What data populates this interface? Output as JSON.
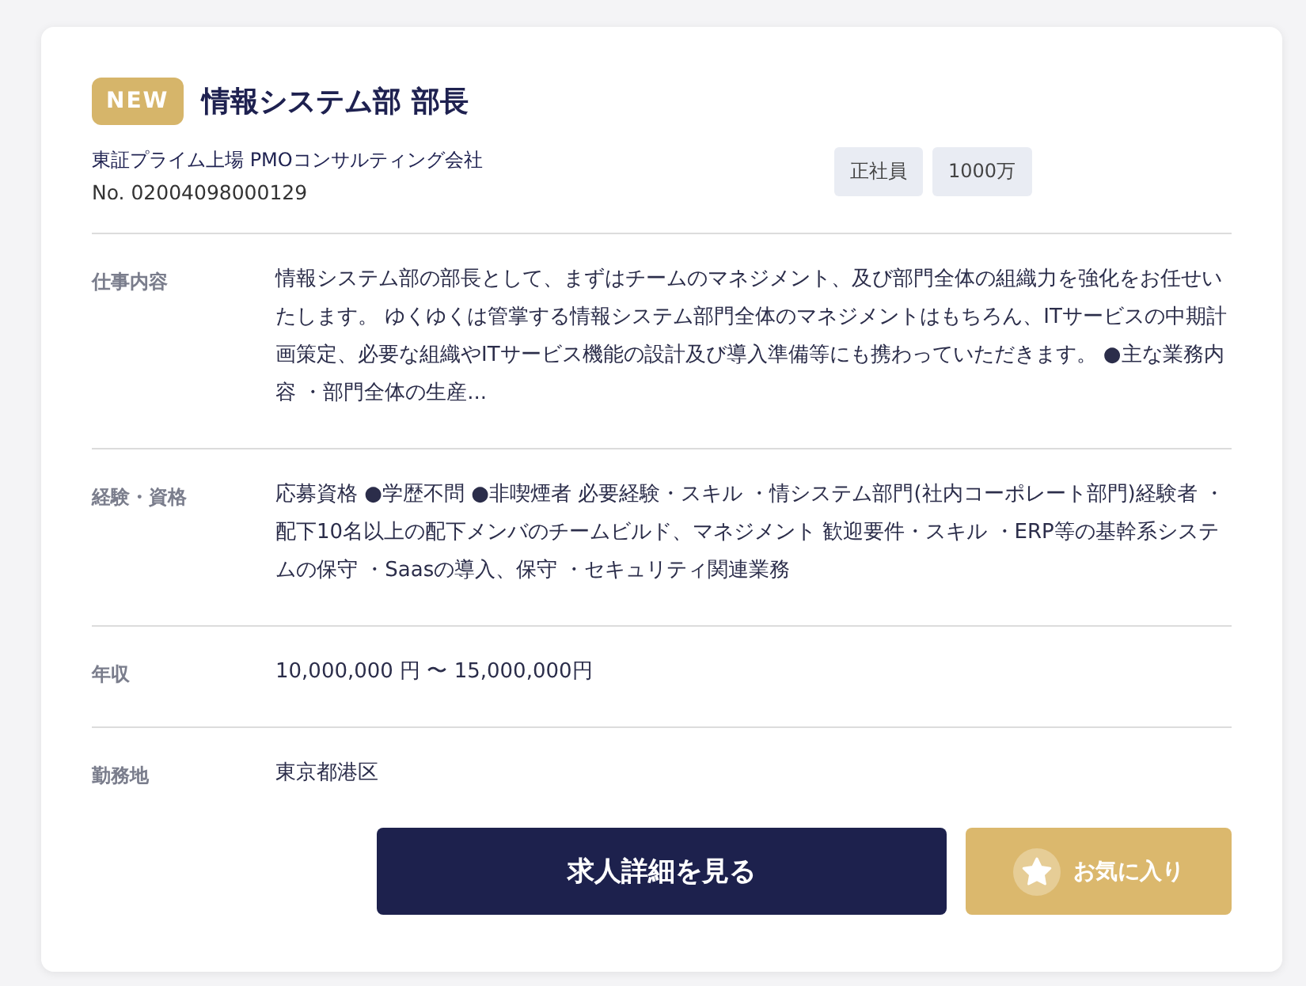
{
  "job": {
    "badge": "NEW",
    "title": "情報システム部 部長",
    "company": "東証プライム上場 PMOコンサルティング会社",
    "number": "No. 02004098000129",
    "tags": [
      "正社員",
      "1000万"
    ],
    "details": [
      {
        "label": "仕事内容",
        "value": "情報システム部の部長として、まずはチームのマネジメント、及び部門全体の組織力を強化をお任せいたします。 ゆくゆくは管掌する情報システム部門全体のマネジメントはもちろん、ITサービスの中期計画策定、必要な組織やITサービス機能の設計及び導入準備等にも携わっていただきます。 ●主な業務内容 ・部門全体の生産..."
      },
      {
        "label": "経験・資格",
        "value": "応募資格 ●学歴不問 ●非喫煙者 必要経験・スキル ・情システム部門(社内コーポレート部門)経験者 ・配下10名以上の配下メンバのチームビルド、マネジメント 歓迎要件・スキル ・ERP等の基幹系システムの保守 ・Saasの導入、保守 ・セキュリティ関連業務"
      },
      {
        "label": "年収",
        "value": "10,000,000 円 〜 15,000,000円"
      },
      {
        "label": "勤務地",
        "value": "東京都港区"
      }
    ],
    "buttons": [
      {
        "kind": "primary",
        "label": "求人詳細を見る"
      },
      {
        "kind": "favorite",
        "label": "お気に入り"
      }
    ]
  }
}
